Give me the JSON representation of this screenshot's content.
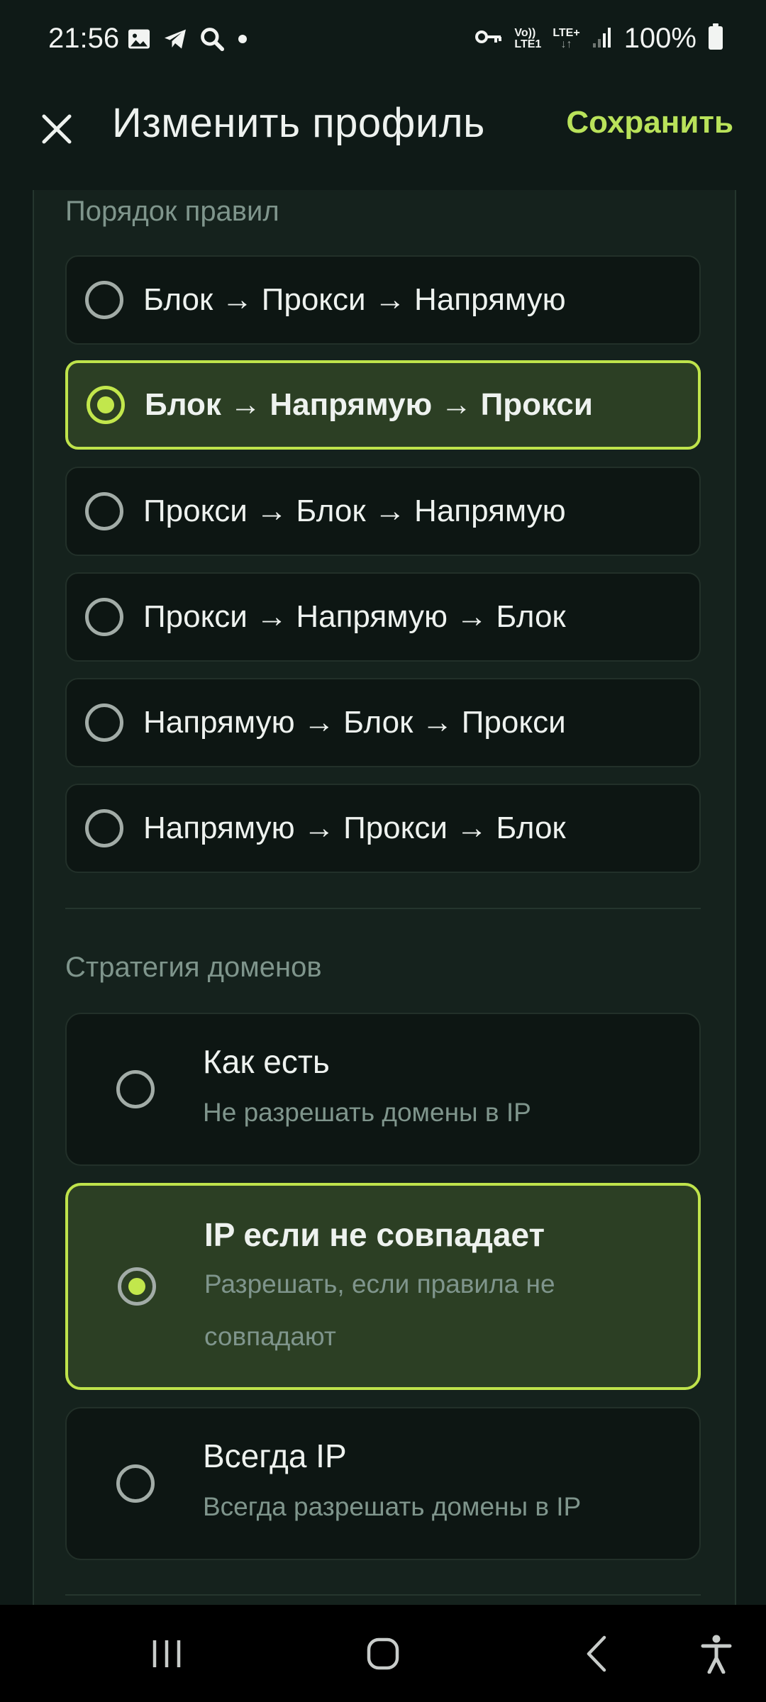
{
  "status_bar": {
    "time": "21:56",
    "left_icons": [
      "gallery-icon",
      "telegram-icon",
      "search-icon",
      "dot-icon"
    ],
    "right_icons": [
      "vpn-key-icon",
      "volte-icon",
      "lte-icon",
      "signal-icon",
      "battery-icon"
    ],
    "volte_top": "Vo))",
    "volte_bottom": "LTE1",
    "lte_top": "LTE+",
    "lte_arrows": "↓↑",
    "battery": "100%"
  },
  "app_bar": {
    "close_icon": "close-icon",
    "title": "Изменить профиль",
    "save_label": "Сохранить"
  },
  "rule_order": {
    "label": "Порядок правил",
    "options": [
      {
        "label": "Блок → Прокси → Напрямую",
        "selected": false
      },
      {
        "label": "Блок → Напрямую → Прокси",
        "selected": true
      },
      {
        "label": "Прокси → Блок → Напрямую",
        "selected": false
      },
      {
        "label": "Прокси → Напрямую → Блок",
        "selected": false
      },
      {
        "label": "Напрямую → Блок → Прокси",
        "selected": false
      },
      {
        "label": "Напрямую → Прокси → Блок",
        "selected": false
      }
    ]
  },
  "domain_strategy": {
    "label": "Стратегия доменов",
    "options": [
      {
        "title": "Как есть",
        "subtitle": "Не разрешать домены в IP",
        "selected": false
      },
      {
        "title": "IP если не совпадает",
        "subtitle": "Разрешать, если правила не совпадают",
        "selected": true
      },
      {
        "title": "Всегда IP",
        "subtitle": "Всегда разрешать домены в IP",
        "selected": false
      }
    ]
  },
  "nav_bar": {
    "items": [
      "recent-apps-icon",
      "home-icon",
      "back-icon",
      "accessibility-icon"
    ]
  },
  "colors": {
    "background": "#0f1a17",
    "panel": "#15221d",
    "accent": "#bfe34b",
    "selected_fill": "#2c3f24",
    "muted_text": "#7f958c"
  }
}
